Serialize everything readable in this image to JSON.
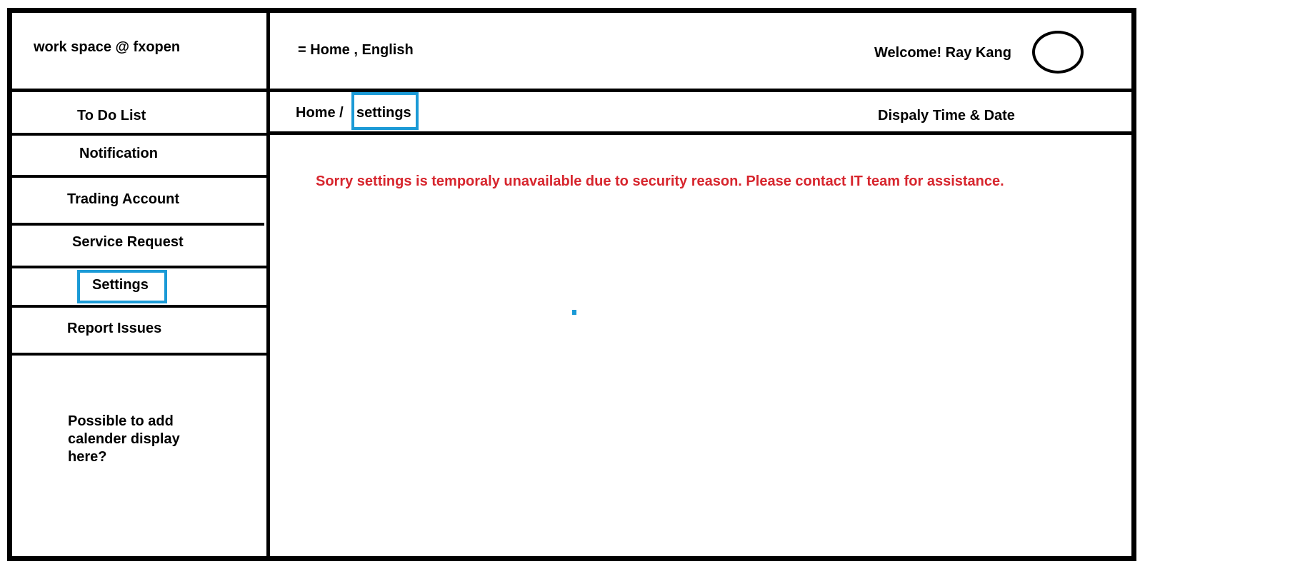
{
  "header": {
    "workspace_title": "work space @ fxopen",
    "nav_text": "= Home , English",
    "welcome_text": "Welcome! Ray Kang"
  },
  "sidebar": {
    "items": [
      {
        "label": "To Do List"
      },
      {
        "label": "Notification"
      },
      {
        "label": "Trading Account"
      },
      {
        "label": "Service Request"
      },
      {
        "label": "Settings"
      },
      {
        "label": "Report Issues"
      }
    ],
    "calendar_note": "Possible to add calender display here?"
  },
  "breadcrumb": {
    "home": "Home /",
    "current": "settings"
  },
  "datetime_placeholder": "Dispaly Time & Date",
  "main": {
    "message": "Sorry settings is temporaly unavailable due to security reason. Please contact IT team for assistance."
  },
  "colors": {
    "highlight": "#1b9ad6",
    "error_text": "#d7262e"
  }
}
